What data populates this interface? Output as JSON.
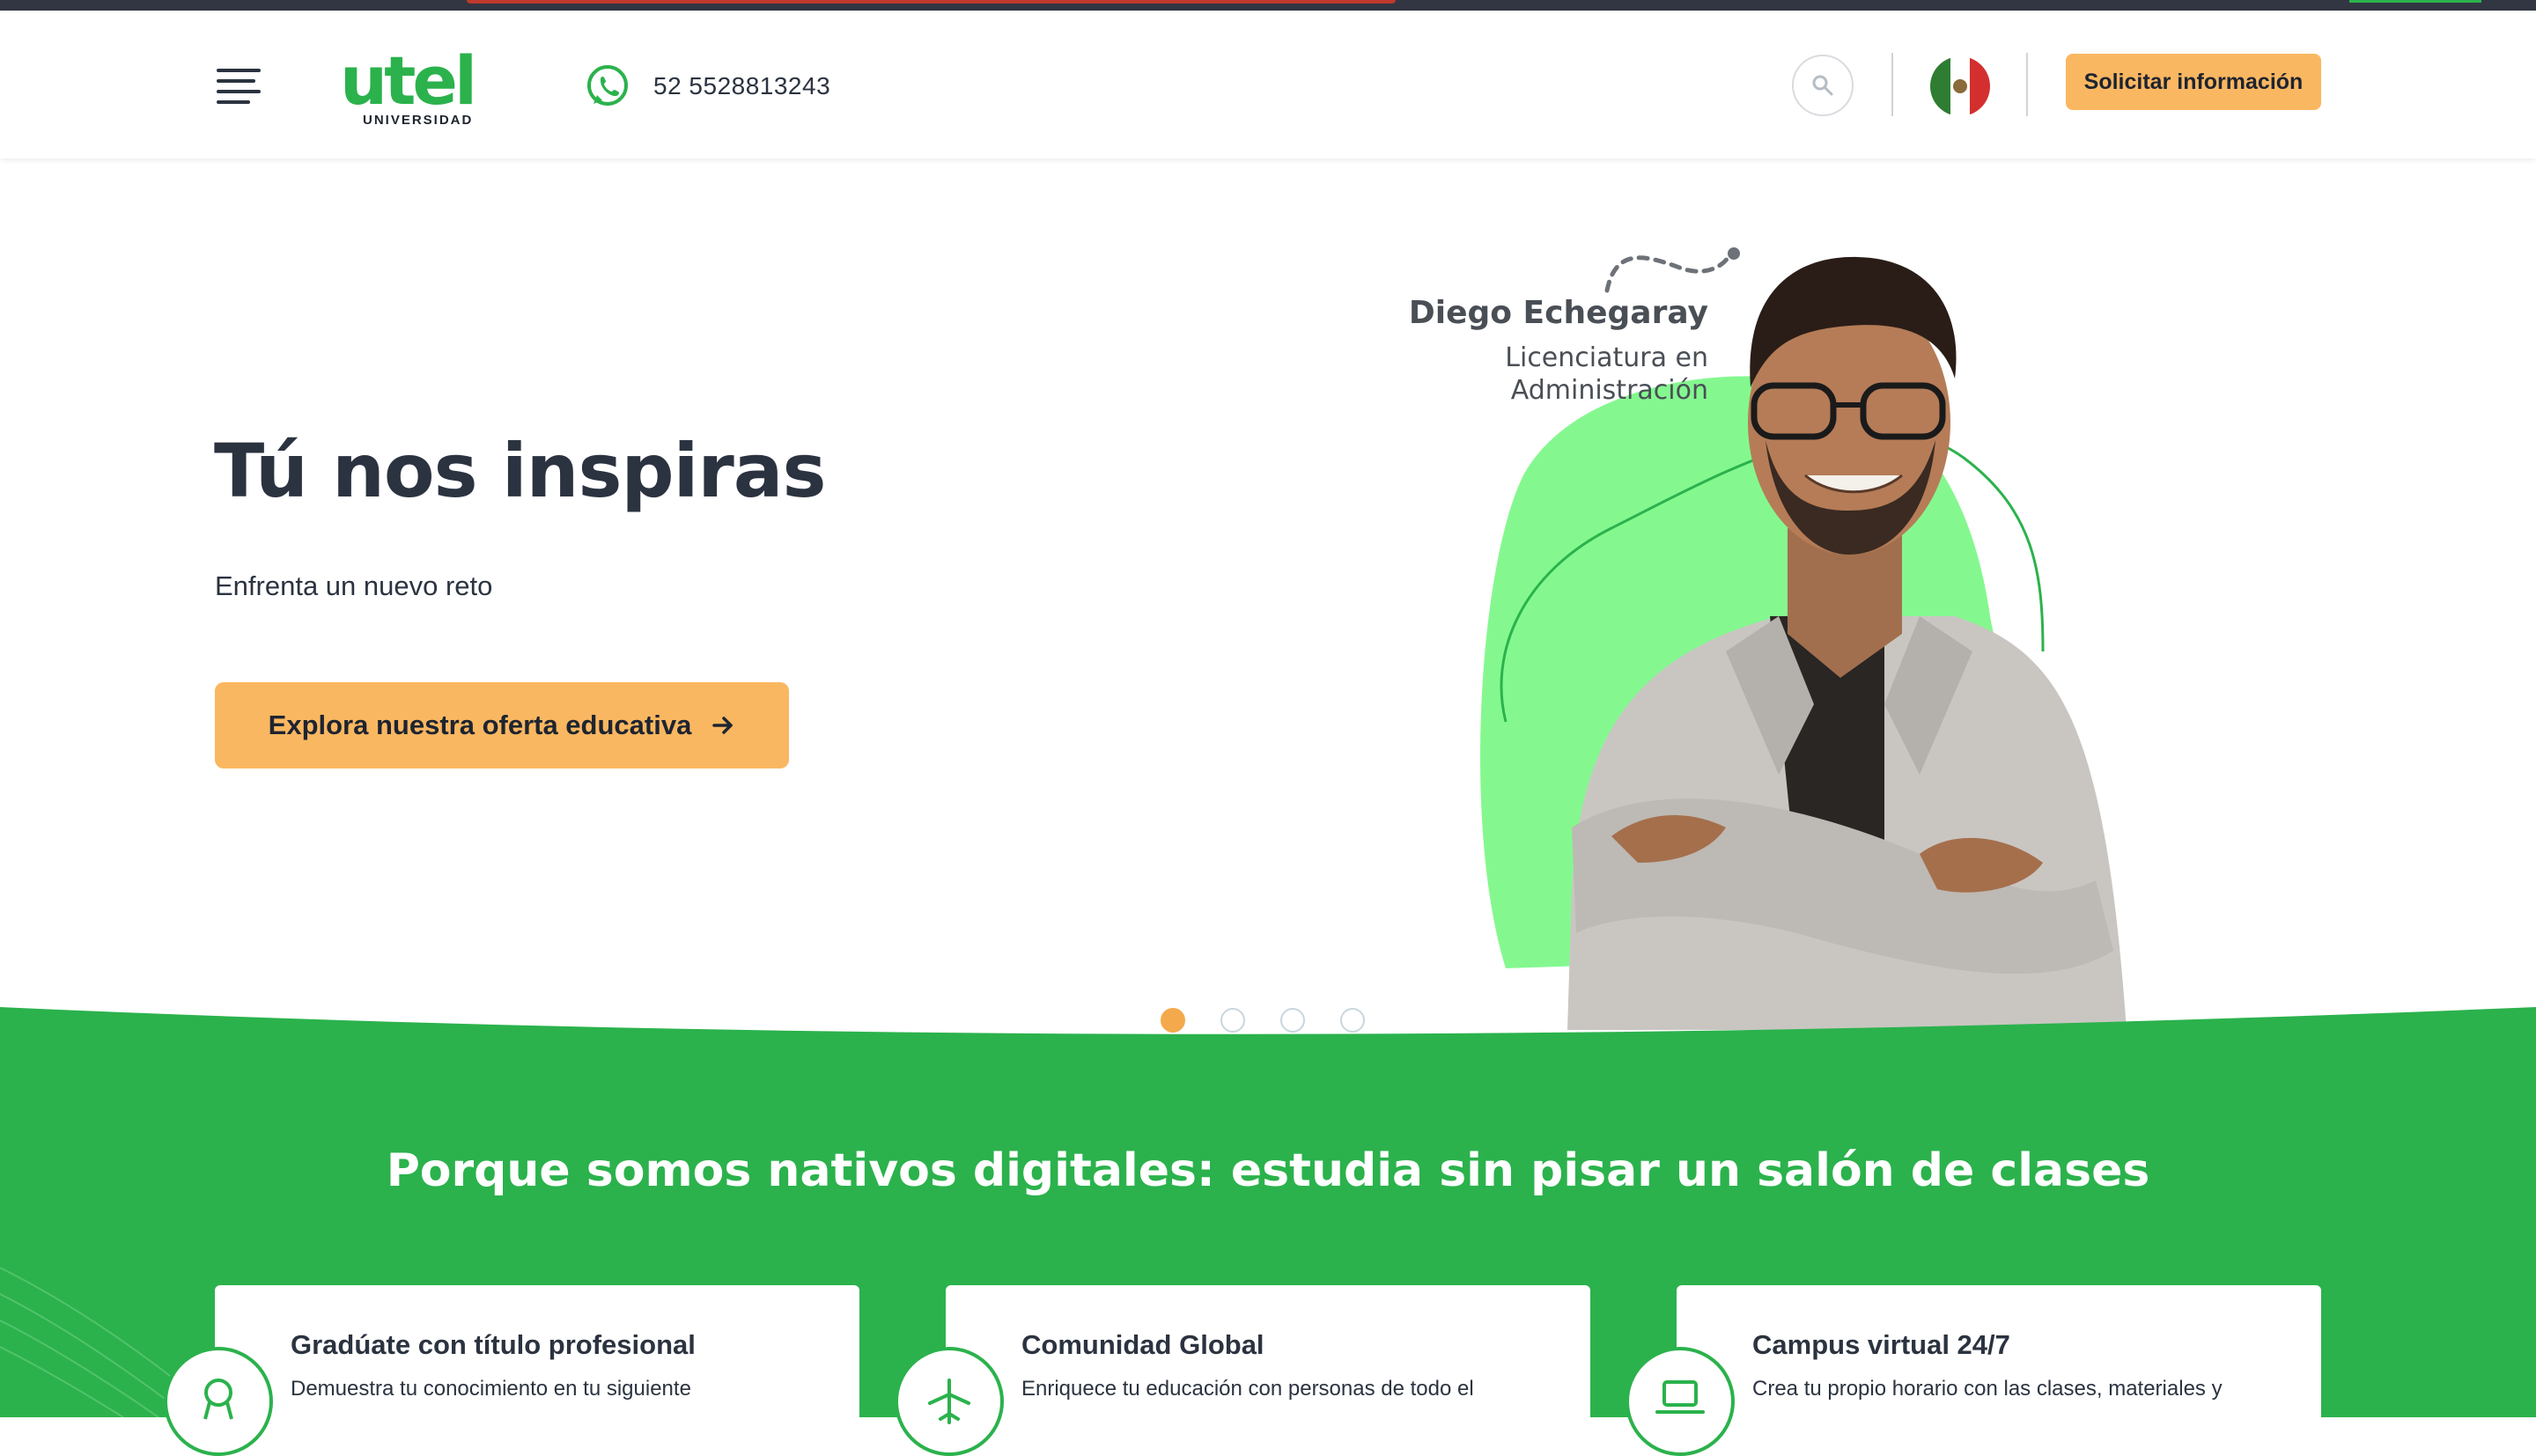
{
  "header": {
    "menu_icon": "hamburger-menu-icon",
    "logo": {
      "word": "utel",
      "sub": "UNIVERSIDAD"
    },
    "whatsapp_icon": "whatsapp-icon",
    "phone": "52 5528813243",
    "search_icon": "search-icon",
    "country_flag": "mexico-flag",
    "cta_label": "Solicitar información"
  },
  "hero": {
    "title": "Tú nos inspiras",
    "subtitle": "Enfrenta un nuevo reto",
    "cta_label": "Explora nuestra oferta educativa",
    "cta_icon": "arrow-right-icon",
    "person_name": "Diego Echegaray",
    "person_program": "Licenciatura en\nAdministración",
    "slides_count": 4,
    "active_slide": 1
  },
  "features": {
    "title": "Porque somos nativos digitales: estudia sin pisar un salón de clases",
    "cards": [
      {
        "title": "Gradúate con título profesional",
        "text": "Demuestra tu conocimiento en tu siguiente",
        "icon": "award-icon"
      },
      {
        "title": "Comunidad Global",
        "text": "Enriquece tu educación con personas de todo el",
        "icon": "airplane-icon"
      },
      {
        "title": "Campus virtual 24/7",
        "text": "Crea tu propio horario con las clases, materiales y",
        "icon": "laptop-icon"
      }
    ]
  },
  "colors": {
    "brand_green": "#2bb24c",
    "accent_orange": "#fab761",
    "text_dark": "#2b3340",
    "blob_green": "#84f88f"
  }
}
